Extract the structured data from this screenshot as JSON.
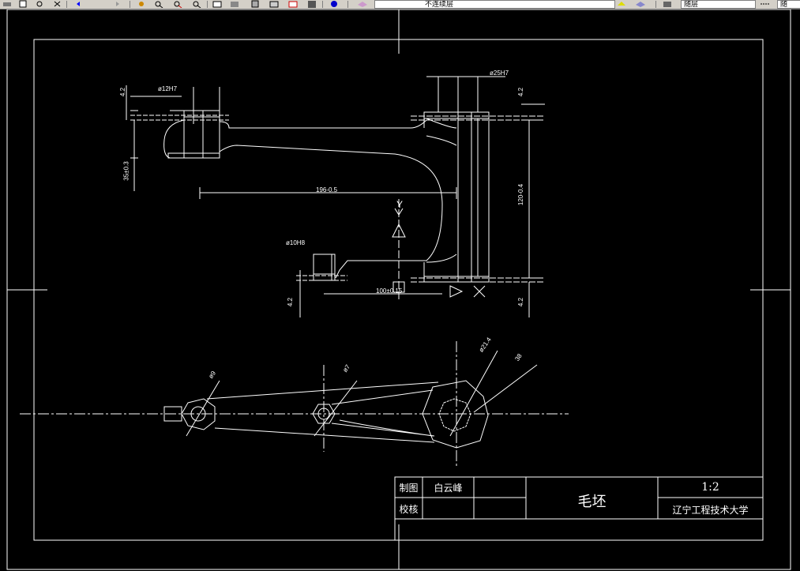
{
  "toolbar": {
    "layer_combo": "不连续层",
    "linetype_combo": "随层",
    "lineweight_combo": "随"
  },
  "title_block": {
    "drawn_by_label": "制图",
    "drawn_by_name": "白云峰",
    "checked_by_label": "校核",
    "part_name": "毛坯",
    "scale": "1:2",
    "institution": "辽宁工程技术大学"
  },
  "dimensions": {
    "d_top_left": "4.2",
    "d_phi12": "ø12H7",
    "d_phi25": "ø25H7",
    "d_top_right": "4.2",
    "d_left_lower": "35±0.3",
    "d_196": "196-0.5",
    "d_right_120": "120-0.4",
    "d_phi10": "ø10H8",
    "d_bottom_left": "4.2",
    "d_100": "100±0.15",
    "d_bottom_right": "4.2",
    "d_9": "ø9",
    "d_7": "ø7",
    "d_21": "ø21.4",
    "d_38": "38"
  },
  "view_labels": {
    "y_axis": "Y",
    "x_axis": "X"
  },
  "colors": {
    "background": "#000000",
    "lines": "#ffffff",
    "ui_gray": "#d4d0c8"
  }
}
